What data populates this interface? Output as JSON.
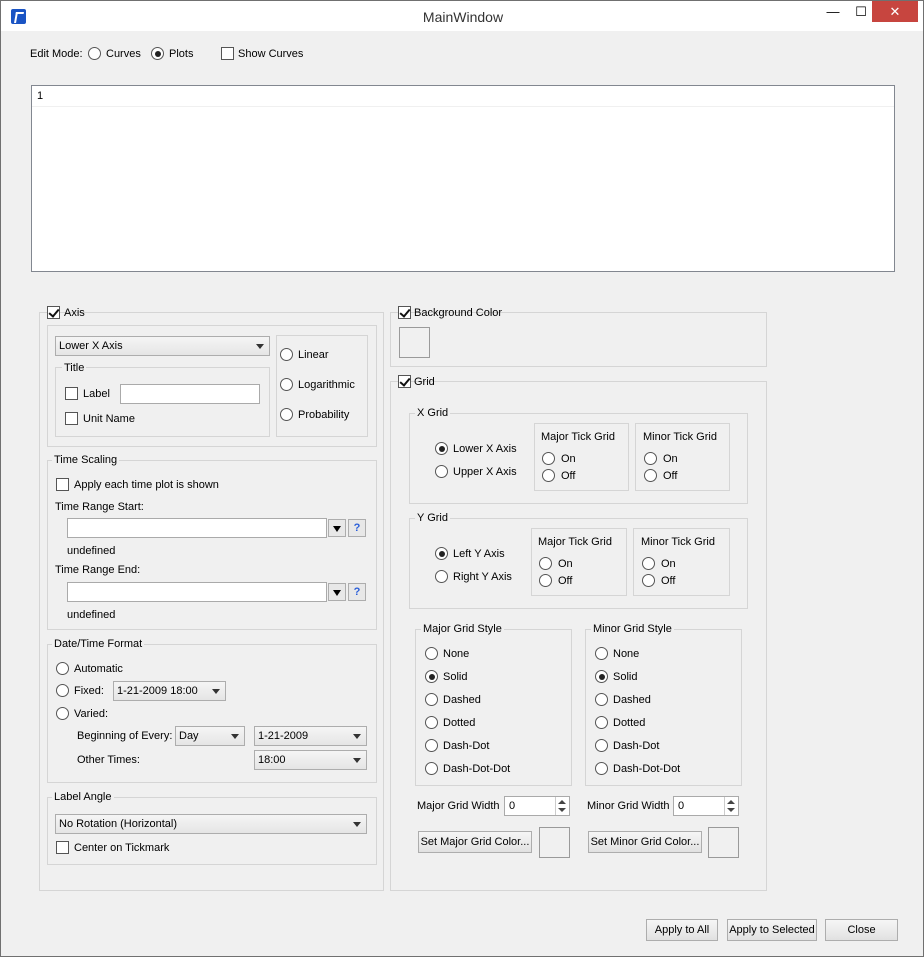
{
  "window": {
    "title": "MainWindow",
    "minimize": "—",
    "maximize": "☐",
    "close": "✕"
  },
  "edit_mode": {
    "label": "Edit Mode:",
    "curves": "Curves",
    "plots": "Plots",
    "selected": "Plots",
    "show_curves": "Show Curves",
    "show_curves_checked": false
  },
  "plot_list": {
    "rows": [
      "1"
    ]
  },
  "axis": {
    "label": "Axis",
    "checked": true,
    "axis_select": "Lower X Axis",
    "title_group": "Title",
    "label_cb": "Label",
    "label_value": "",
    "unit_name_cb": "Unit Name",
    "scale_linear": "Linear",
    "scale_log": "Logarithmic",
    "scale_prob": "Probability"
  },
  "time_scaling": {
    "group": "Time Scaling",
    "apply_each": "Apply each time plot is shown",
    "start_label": "Time Range Start:",
    "start_value": "",
    "start_status": "undefined",
    "end_label": "Time Range End:",
    "end_value": "",
    "end_status": "undefined",
    "help": "?"
  },
  "datetime_format": {
    "group": "Date/Time Format",
    "automatic": "Automatic",
    "fixed": "Fixed:",
    "fixed_value": "1-21-2009 18:00",
    "varied": "Varied:",
    "beginning_label": "Beginning of Every:",
    "beginning_unit": "Day",
    "beginning_date": "1-21-2009",
    "other_label": "Other Times:",
    "other_value": "18:00"
  },
  "label_angle": {
    "group": "Label Angle",
    "value": "No Rotation (Horizontal)",
    "center": "Center on Tickmark"
  },
  "background": {
    "label": "Background Color",
    "checked": true
  },
  "grid": {
    "label": "Grid",
    "checked": true,
    "x_grid": {
      "group": "X Grid",
      "axis1": "Lower X Axis",
      "axis2": "Upper X Axis",
      "major": "Major Tick Grid",
      "minor": "Minor Tick Grid",
      "on": "On",
      "off": "Off"
    },
    "y_grid": {
      "group": "Y Grid",
      "axis1": "Left Y Axis",
      "axis2": "Right Y Axis",
      "major": "Major Tick Grid",
      "minor": "Minor Tick Grid",
      "on": "On",
      "off": "Off"
    },
    "major_style": {
      "group": "Major Grid Style",
      "options": [
        "None",
        "Solid",
        "Dashed",
        "Dotted",
        "Dash-Dot",
        "Dash-Dot-Dot"
      ],
      "selected": "Solid"
    },
    "minor_style": {
      "group": "Minor Grid Style",
      "options": [
        "None",
        "Solid",
        "Dashed",
        "Dotted",
        "Dash-Dot",
        "Dash-Dot-Dot"
      ],
      "selected": "Solid"
    },
    "major_width_label": "Major Grid Width",
    "major_width": "0",
    "minor_width_label": "Minor Grid Width",
    "minor_width": "0",
    "set_major_color": "Set Major Grid Color...",
    "set_minor_color": "Set Minor Grid Color..."
  },
  "footer": {
    "apply_all": "Apply to All",
    "apply_selected": "Apply to Selected",
    "close": "Close"
  }
}
